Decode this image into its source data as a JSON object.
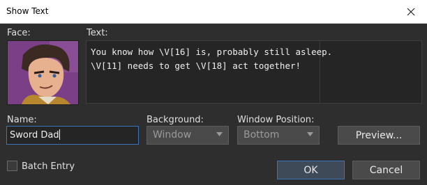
{
  "window": {
    "title": "Show Text"
  },
  "labels": {
    "face": "Face:",
    "text": "Text:",
    "name": "Name:",
    "background": "Background:",
    "window_position": "Window Position:"
  },
  "message_lines": [
    "You know how \\V[16] is, probably still asleep.",
    "\\V[11] needs to get \\V[18] act together!"
  ],
  "name_value": "Sword Dad",
  "background_select": {
    "value": "Window"
  },
  "position_select": {
    "value": "Bottom"
  },
  "buttons": {
    "preview": "Preview...",
    "ok": "OK",
    "cancel": "Cancel"
  },
  "batch_entry": {
    "label": "Batch Entry",
    "checked": false
  },
  "icons": {
    "close": "close-icon",
    "dropdown": "chevron-down-icon",
    "face": "face-portrait"
  },
  "colors": {
    "accent": "#3b74b8",
    "face_bg": "#7a3f86"
  }
}
